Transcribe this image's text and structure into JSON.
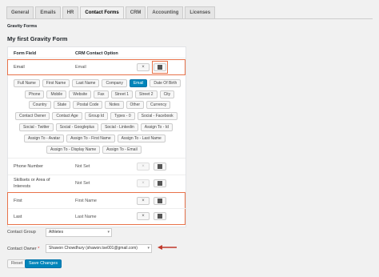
{
  "tabs": [
    "General",
    "Emails",
    "HR",
    "Contact Forms",
    "CRM",
    "Accounting",
    "Licenses"
  ],
  "active_tab": "Contact Forms",
  "section_title": "Gravity Forms",
  "form_title": "My first Gravity Form",
  "columns": {
    "field": "Form Field",
    "option": "CRM Contact Option"
  },
  "rows": {
    "email": {
      "label": "Email",
      "value": "Email"
    },
    "phone": {
      "label": "Phone Number",
      "value": "Not Set"
    },
    "skillsets": {
      "label_line1": "Skillsets or Area of",
      "label_line2": "Interests",
      "value": "Not Set"
    },
    "first": {
      "label": "First",
      "value": "First Name"
    },
    "last": {
      "label": "Last",
      "value": "Last Name"
    }
  },
  "tag_rows": [
    [
      "Full Name",
      "First Name",
      "Last Name",
      "Company",
      "Email",
      "Date Of Birth"
    ],
    [
      "Phone",
      "Mobile",
      "Website",
      "Fax",
      "Street 1",
      "Street 2",
      "City"
    ],
    [
      "Country",
      "State",
      "Postal Code",
      "Notes",
      "Other",
      "Currency"
    ],
    [
      "Contact Owner",
      "Contact Age",
      "Group Id",
      "Types - 0",
      "Social - Facebook"
    ],
    [
      "Social - Twitter",
      "Social - Googleplus",
      "Social - Linkedin",
      "Assign To - Id"
    ],
    [
      "Assign To - Avatar",
      "Assign To - First Name",
      "Assign To - Last Name"
    ],
    [
      "Assign To - Display Name",
      "Assign To - Email"
    ]
  ],
  "active_tag": "Email",
  "contact_group": {
    "label": "Contact Group",
    "value": "Athletes"
  },
  "contact_owner": {
    "label": "Contact Owner",
    "required_mark": "*",
    "value": "Shawon Chowdhury (shawon.tse001@gmail.com)"
  },
  "buttons": {
    "reset": "Reset",
    "save": "Save Changes"
  },
  "icons": {
    "clear": "×"
  },
  "colors": {
    "highlight": "#e8734a",
    "primary": "#0085ba",
    "arrow": "#c0392b"
  }
}
